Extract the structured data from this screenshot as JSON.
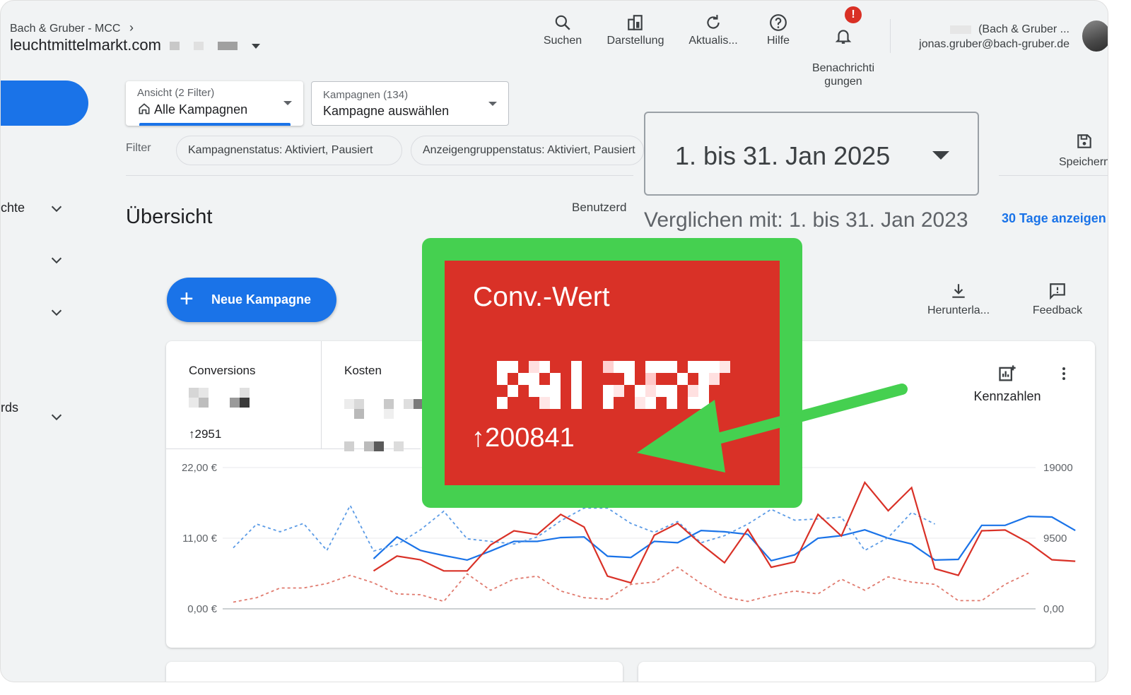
{
  "header": {
    "breadcrumb": "Bach & Gruber - MCC",
    "account": "leuchtmittelmarkt.com",
    "actions": [
      {
        "label": "Suchen",
        "icon": "search-icon"
      },
      {
        "label": "Darstellung",
        "icon": "appearance-icon"
      },
      {
        "label": "Aktualis...",
        "icon": "refresh-icon"
      },
      {
        "label": "Hilfe",
        "icon": "help-icon"
      },
      {
        "label": "Benachrichti\ngungen",
        "icon": "bell-icon",
        "badge": "!"
      }
    ],
    "user_line1": "(Bach & Gruber ...",
    "user_line2": "jonas.gruber@bach-gruber.de"
  },
  "sidebar": {
    "items": [
      {
        "label": "chte"
      },
      {
        "label": ""
      },
      {
        "label": ""
      },
      {
        "label": "rds"
      }
    ]
  },
  "view_selector": {
    "small": "Ansicht (2 Filter)",
    "big": "Alle Kampagnen"
  },
  "campaign_selector": {
    "small": "Kampagnen (134)",
    "big": "Kampagne auswählen"
  },
  "filter": {
    "label": "Filter",
    "chips": [
      "Kampagnenstatus: Aktiviert, Pausiert",
      "Anzeigengruppenstatus: Aktiviert, Pausiert"
    ]
  },
  "date": {
    "range": "1. bis 31. Jan 2025",
    "compare": "Verglichen mit: 1. bis 31. Jan 2023",
    "link": "30 Tage anzeigen",
    "save": "Speichern"
  },
  "page": {
    "title": "Übersicht",
    "custom": "Benutzerd"
  },
  "new_campaign": "Neue Kampagne",
  "tools": {
    "download": "Herunterla...",
    "feedback": "Feedback"
  },
  "metrics": {
    "conversions_label": "Conversions",
    "conversions_change": "2951",
    "kosten_label": "Kosten",
    "kennzahlen": "Kennzahlen"
  },
  "highlight": {
    "label": "Conv.-Wert",
    "change": "200841",
    "colors": {
      "frame": "#45d050",
      "box": "#d93127"
    }
  },
  "chart_data": {
    "type": "line",
    "y_left_ticks": [
      "22,00 €",
      "11,00 €",
      "0,00 €"
    ],
    "y_right_ticks": [
      "19000",
      "9500",
      "0,00"
    ],
    "ylim_left": [
      0,
      22
    ],
    "ylim_right": [
      0,
      19000
    ],
    "series": [
      {
        "name": "Kosten",
        "axis": "left",
        "color": "#1a73e8",
        "style": "solid",
        "start": 6,
        "values": [
          7.8,
          11.2,
          9.1,
          8.3,
          7.6,
          9.0,
          10.5,
          10.5,
          11.1,
          11.2,
          8.2,
          8.0,
          10.5,
          10.3,
          12.2,
          12.0,
          11.6,
          7.5,
          8.4,
          11.0,
          11.4,
          12.3,
          11.0,
          10.1,
          7.6,
          7.7,
          13.0,
          13.0,
          14.4,
          14.3,
          12.2
        ]
      },
      {
        "name": "",
        "axis": "left",
        "color": "#5b9be6",
        "style": "dashed",
        "start": 0,
        "values": [
          9.5,
          13.2,
          12.0,
          13.3,
          9.1,
          16.1,
          9.0,
          10.0,
          12.3,
          15.2,
          10.9,
          10.5,
          10.1,
          11.2,
          13.7,
          15.7,
          15.7,
          13.3,
          11.9,
          13.6,
          10.3,
          11.4,
          13.2,
          15.5,
          13.8,
          14.0,
          14.3,
          9.1,
          11.1,
          15.0,
          13.2
        ]
      },
      {
        "name": "Conv.-Wert",
        "axis": "right",
        "color": "#d93127",
        "style": "solid",
        "start": 6,
        "values": [
          5100,
          7100,
          6600,
          5100,
          5100,
          8600,
          10500,
          10000,
          12700,
          11000,
          4400,
          3500,
          9900,
          11500,
          8700,
          6200,
          10700,
          5600,
          6300,
          12700,
          9800,
          17000,
          13200,
          16300,
          5400,
          4500,
          10500,
          10600,
          8900,
          6600,
          6400
        ]
      },
      {
        "name": "",
        "axis": "right",
        "color": "#e07a6e",
        "style": "dashed",
        "start": 0,
        "values": [
          900,
          1500,
          2800,
          2800,
          3400,
          4500,
          3500,
          2000,
          1900,
          1000,
          4700,
          2500,
          4000,
          4400,
          2400,
          1500,
          1300,
          3300,
          3600,
          5600,
          3400,
          1600,
          1000,
          1800,
          2400,
          2000,
          4000,
          2500,
          4300,
          3600,
          3300,
          1100,
          1100,
          3300,
          4800
        ]
      }
    ]
  }
}
